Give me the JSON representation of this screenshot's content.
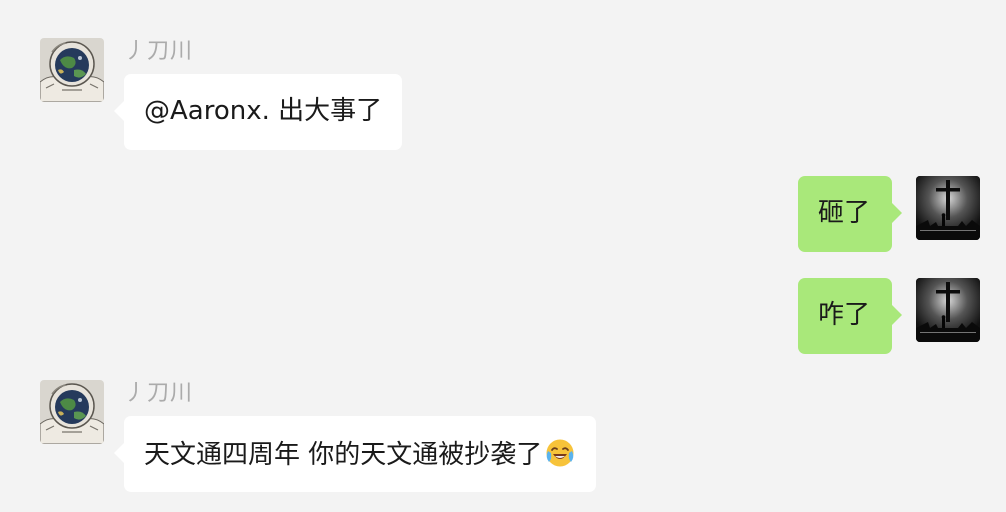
{
  "messages": [
    {
      "direction": "incoming",
      "sender": "丿刀川",
      "avatar": "astronaut-avatar",
      "text": "@Aaronx. 出大事了"
    },
    {
      "direction": "outgoing",
      "avatar": "cross-silhouette-avatar",
      "text": "砸了"
    },
    {
      "direction": "outgoing",
      "avatar": "cross-silhouette-avatar",
      "text": "咋了"
    },
    {
      "direction": "incoming",
      "sender": "丿刀川",
      "avatar": "astronaut-avatar",
      "text": "天文通四周年 你的天文通被抄袭了",
      "emoji": "face-with-tears-of-joy-icon"
    }
  ],
  "colors": {
    "background": "#f3f3f3",
    "incoming_bubble": "#ffffff",
    "outgoing_bubble": "#a9e87a",
    "sender_name": "#ababab"
  }
}
